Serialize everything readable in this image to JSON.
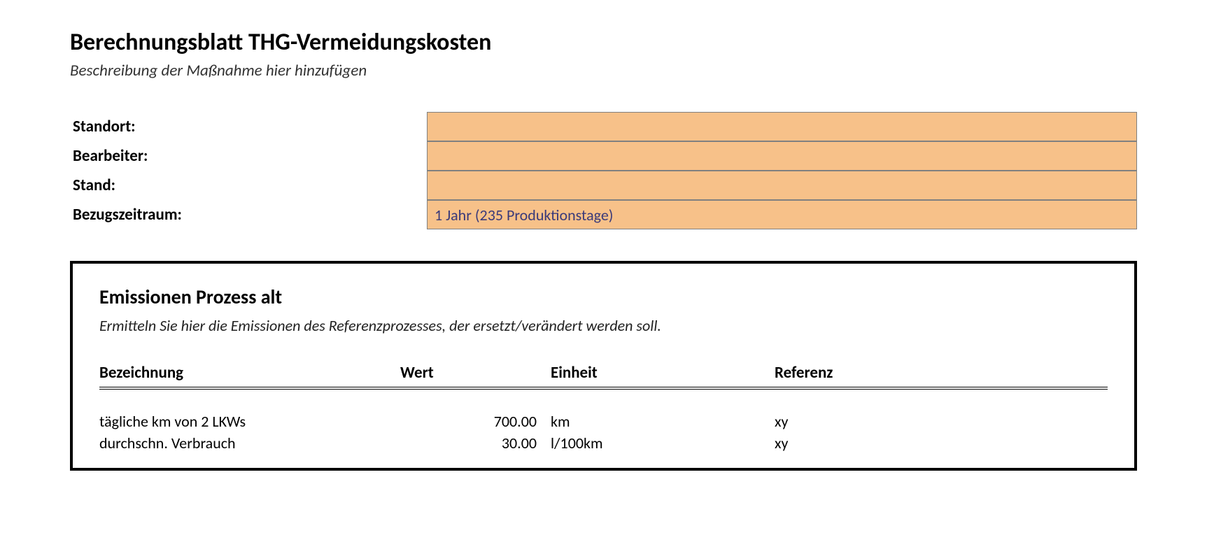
{
  "header": {
    "title": "Berechnungsblatt THG-Vermeidungskosten",
    "subtitle": "Beschreibung der Maßnahme hier hinzufügen"
  },
  "meta": {
    "rows": [
      {
        "label": "Standort:",
        "value": ""
      },
      {
        "label": "Bearbeiter:",
        "value": ""
      },
      {
        "label": "Stand:",
        "value": ""
      },
      {
        "label": "Bezugszeitraum:",
        "value": "1 Jahr (235 Produktionstage)"
      }
    ]
  },
  "section": {
    "title": "Emissionen Prozess alt",
    "desc": "Ermitteln Sie hier die Emissionen des Referenzprozesses, der ersetzt/verändert werden soll.",
    "columns": {
      "bezeichnung": "Bezeichnung",
      "wert": "Wert",
      "einheit": "Einheit",
      "referenz": "Referenz"
    },
    "rows": [
      {
        "bezeichnung": "tägliche km von 2 LKWs",
        "wert": "700.00",
        "einheit": "km",
        "referenz": "xy"
      },
      {
        "bezeichnung": "durchschn. Verbrauch",
        "wert": "30.00",
        "einheit": "l/100km",
        "referenz": "xy"
      }
    ]
  }
}
